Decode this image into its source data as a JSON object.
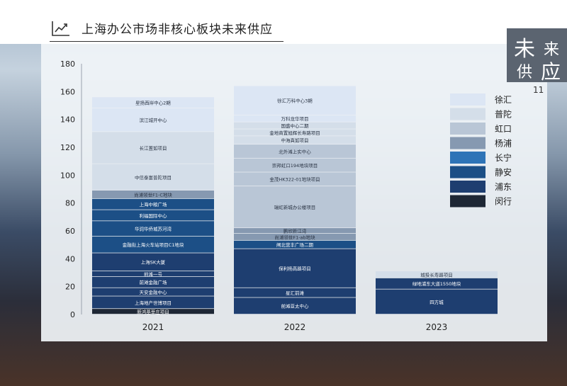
{
  "header": {
    "title": "上海办公市场非核心板块未来供应"
  },
  "badge": {
    "char1": "未",
    "char2": "来",
    "char3": "供",
    "char4": "应"
  },
  "page_number": "11",
  "colors": {
    "徐汇": "#dce6f4",
    "普陀": "#d4dee9",
    "虹口": "#b9c6d6",
    "杨浦": "#8699b1",
    "长宁": "#2e74b7",
    "静安": "#1c4f86",
    "浦东": "#1e3e70",
    "闵行": "#1e2735"
  },
  "chart_data": {
    "type": "bar",
    "stacked": true,
    "ylim": [
      0,
      180
    ],
    "yticks": [
      0,
      20,
      40,
      60,
      80,
      100,
      120,
      140,
      160,
      180
    ],
    "categories": [
      "2021",
      "2022",
      "2023"
    ],
    "legend": [
      "徐汇",
      "普陀",
      "虹口",
      "杨浦",
      "长宁",
      "静安",
      "浦东",
      "闵行"
    ],
    "legend_position": "right",
    "stacks": [
      {
        "category": "2021",
        "segments": [
          {
            "label": "新鸿基莘庄项目",
            "district": "闵行",
            "value": 4
          },
          {
            "label": "上海地产世博项目",
            "district": "浦东",
            "value": 9
          },
          {
            "label": "天安金融中心",
            "district": "浦东",
            "value": 6
          },
          {
            "label": "前滩金融广场",
            "district": "浦东",
            "value": 8
          },
          {
            "label": "前滩一号",
            "district": "浦东",
            "value": 4
          },
          {
            "label": "上海SK大厦",
            "district": "浦东",
            "value": 13
          },
          {
            "label": "金融街上海火车站项目C1地块",
            "district": "静安",
            "value": 12
          },
          {
            "label": "华润华侨城苏河湾",
            "district": "静安",
            "value": 11
          },
          {
            "label": "利福国际中心",
            "district": "静安",
            "value": 8
          },
          {
            "label": "上海中粮广场",
            "district": "静安",
            "value": 8
          },
          {
            "label": "尚浦领世F1-C地块",
            "district": "杨浦",
            "value": 6
          },
          {
            "label": "中信泰富普陀项目",
            "district": "普陀",
            "value": 19
          },
          {
            "label": "长江置如项目",
            "district": "普陀",
            "value": 23
          },
          {
            "label": "滨江城开中心",
            "district": "徐汇",
            "value": 17
          },
          {
            "label": "星扬西岸中心2期",
            "district": "徐汇",
            "value": 8
          }
        ]
      },
      {
        "category": "2022",
        "segments": [
          {
            "label": "前滩亚太中心",
            "district": "浦东",
            "value": 12
          },
          {
            "label": "星汇前滩",
            "district": "浦东",
            "value": 7
          },
          {
            "label": "保利杨高路项目",
            "district": "浦东",
            "value": 28
          },
          {
            "label": "闸北营丰广场二期",
            "district": "静安",
            "value": 6
          },
          {
            "label": "尚浦领世F1-ab地块",
            "district": "杨浦",
            "value": 5
          },
          {
            "label": "鹏欣新江湾",
            "district": "杨浦",
            "value": 4
          },
          {
            "label": "瑞虹新城办公楼项目",
            "district": "虹口",
            "value": 30
          },
          {
            "label": "金茂HK322-01地块项目",
            "district": "虹口",
            "value": 10
          },
          {
            "label": "崇邦虹口194地块项目",
            "district": "虹口",
            "value": 10
          },
          {
            "label": "北外滩上实中心",
            "district": "虹口",
            "value": 10
          },
          {
            "label": "中海真如项目",
            "district": "普陀",
            "value": 6
          },
          {
            "label": "金地商置旭辉长寿路项目",
            "district": "普陀",
            "value": 5
          },
          {
            "label": "国盛中心二期",
            "district": "普陀",
            "value": 5
          },
          {
            "label": "万科龙华项目",
            "district": "徐汇",
            "value": 5
          },
          {
            "label": "徐汇万科中心3期",
            "district": "徐汇",
            "value": 21
          }
        ]
      },
      {
        "category": "2023",
        "segments": [
          {
            "label": "四方城",
            "district": "浦东",
            "value": 18
          },
          {
            "label": "绿地浦东大道1550地块",
            "district": "浦东",
            "value": 8
          },
          {
            "label": "城投长寿路项目",
            "district": "普陀",
            "value": 5
          }
        ]
      }
    ]
  }
}
